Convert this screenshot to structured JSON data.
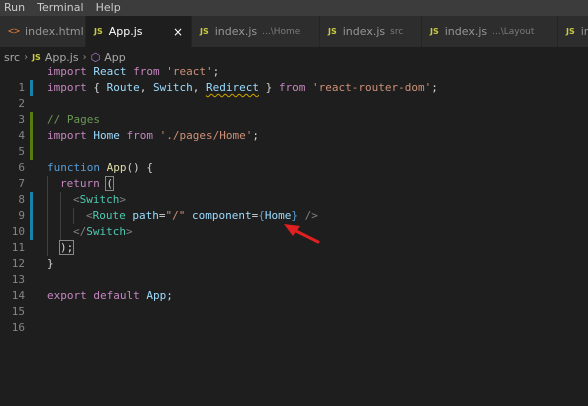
{
  "menu": {
    "items": [
      "Run",
      "Terminal",
      "Help"
    ]
  },
  "tabs": [
    {
      "label": "index.html",
      "desc": "",
      "icon": "html-icon"
    },
    {
      "label": "App.js",
      "desc": "",
      "icon": "js-icon",
      "active": true
    },
    {
      "label": "index.js",
      "desc": "...\\Home",
      "icon": "js-icon"
    },
    {
      "label": "index.js",
      "desc": "src",
      "icon": "js-icon"
    },
    {
      "label": "index.js",
      "desc": "...\\Layout",
      "icon": "js-icon"
    },
    {
      "label": "in",
      "desc": "",
      "icon": "js-icon"
    }
  ],
  "tab_icons": {
    "js": "JS",
    "html": "<>",
    "close": "×"
  },
  "breadcrumb": {
    "folder": "src",
    "file": "App.js",
    "symbol": "App"
  },
  "editor": {
    "line_numbers": [
      "1",
      "2",
      "3",
      "4",
      "5",
      "6",
      "7",
      "8",
      "9",
      "10",
      "11",
      "12",
      "13",
      "14",
      "15",
      "16"
    ],
    "tokens": {
      "import": "import",
      "from": "from",
      "react_ident": "React",
      "react_str": "'react'",
      "brace_open": "{ ",
      "route": "Route",
      "comma": ", ",
      "switch": "Switch",
      "redirect": "Redirect",
      "brace_close": " }",
      "router_str": "'react-router-dom'",
      "semicolon": ";",
      "comment": "// Pages",
      "home": "Home",
      "home_str": "'./pages/Home'",
      "function": "function",
      "app": "App",
      "fn_tail": "() {",
      "return": "return",
      "paren_open": "(",
      "lt": "<",
      "gt": ">",
      "route_path_attr": "path",
      "eq": "=",
      "path_val": "\"/\"",
      "component_attr": "component",
      "brace_l": "{",
      "brace_r": "}",
      "self_close": " />",
      "close_lt": "</",
      "paren_close_semi": ");",
      "close_brace": "}",
      "export": "export",
      "default": "default",
      "app_semi": "App;"
    }
  },
  "colors": {
    "annotation_arrow": "#e02020"
  }
}
